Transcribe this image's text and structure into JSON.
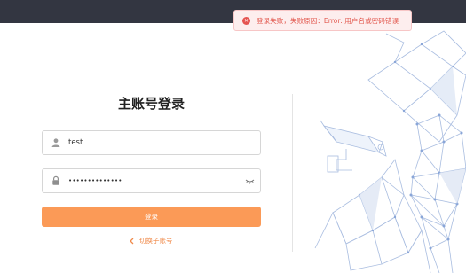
{
  "toast": {
    "icon": "error-x-icon",
    "message": "登录失败，失败原因：Error: 用户名或密码错误",
    "color": "#e2584e"
  },
  "form": {
    "title": "主账号登录",
    "username": {
      "icon": "user-icon",
      "value": "test"
    },
    "password": {
      "icon": "lock-icon",
      "masked_value": "••••••••••••••",
      "toggle_icon": "eye-closed-icon"
    },
    "login_button": "登录",
    "switch_link": "切换子账号"
  },
  "theme": {
    "accent": "#fb9a57",
    "topbar": "#333641"
  }
}
